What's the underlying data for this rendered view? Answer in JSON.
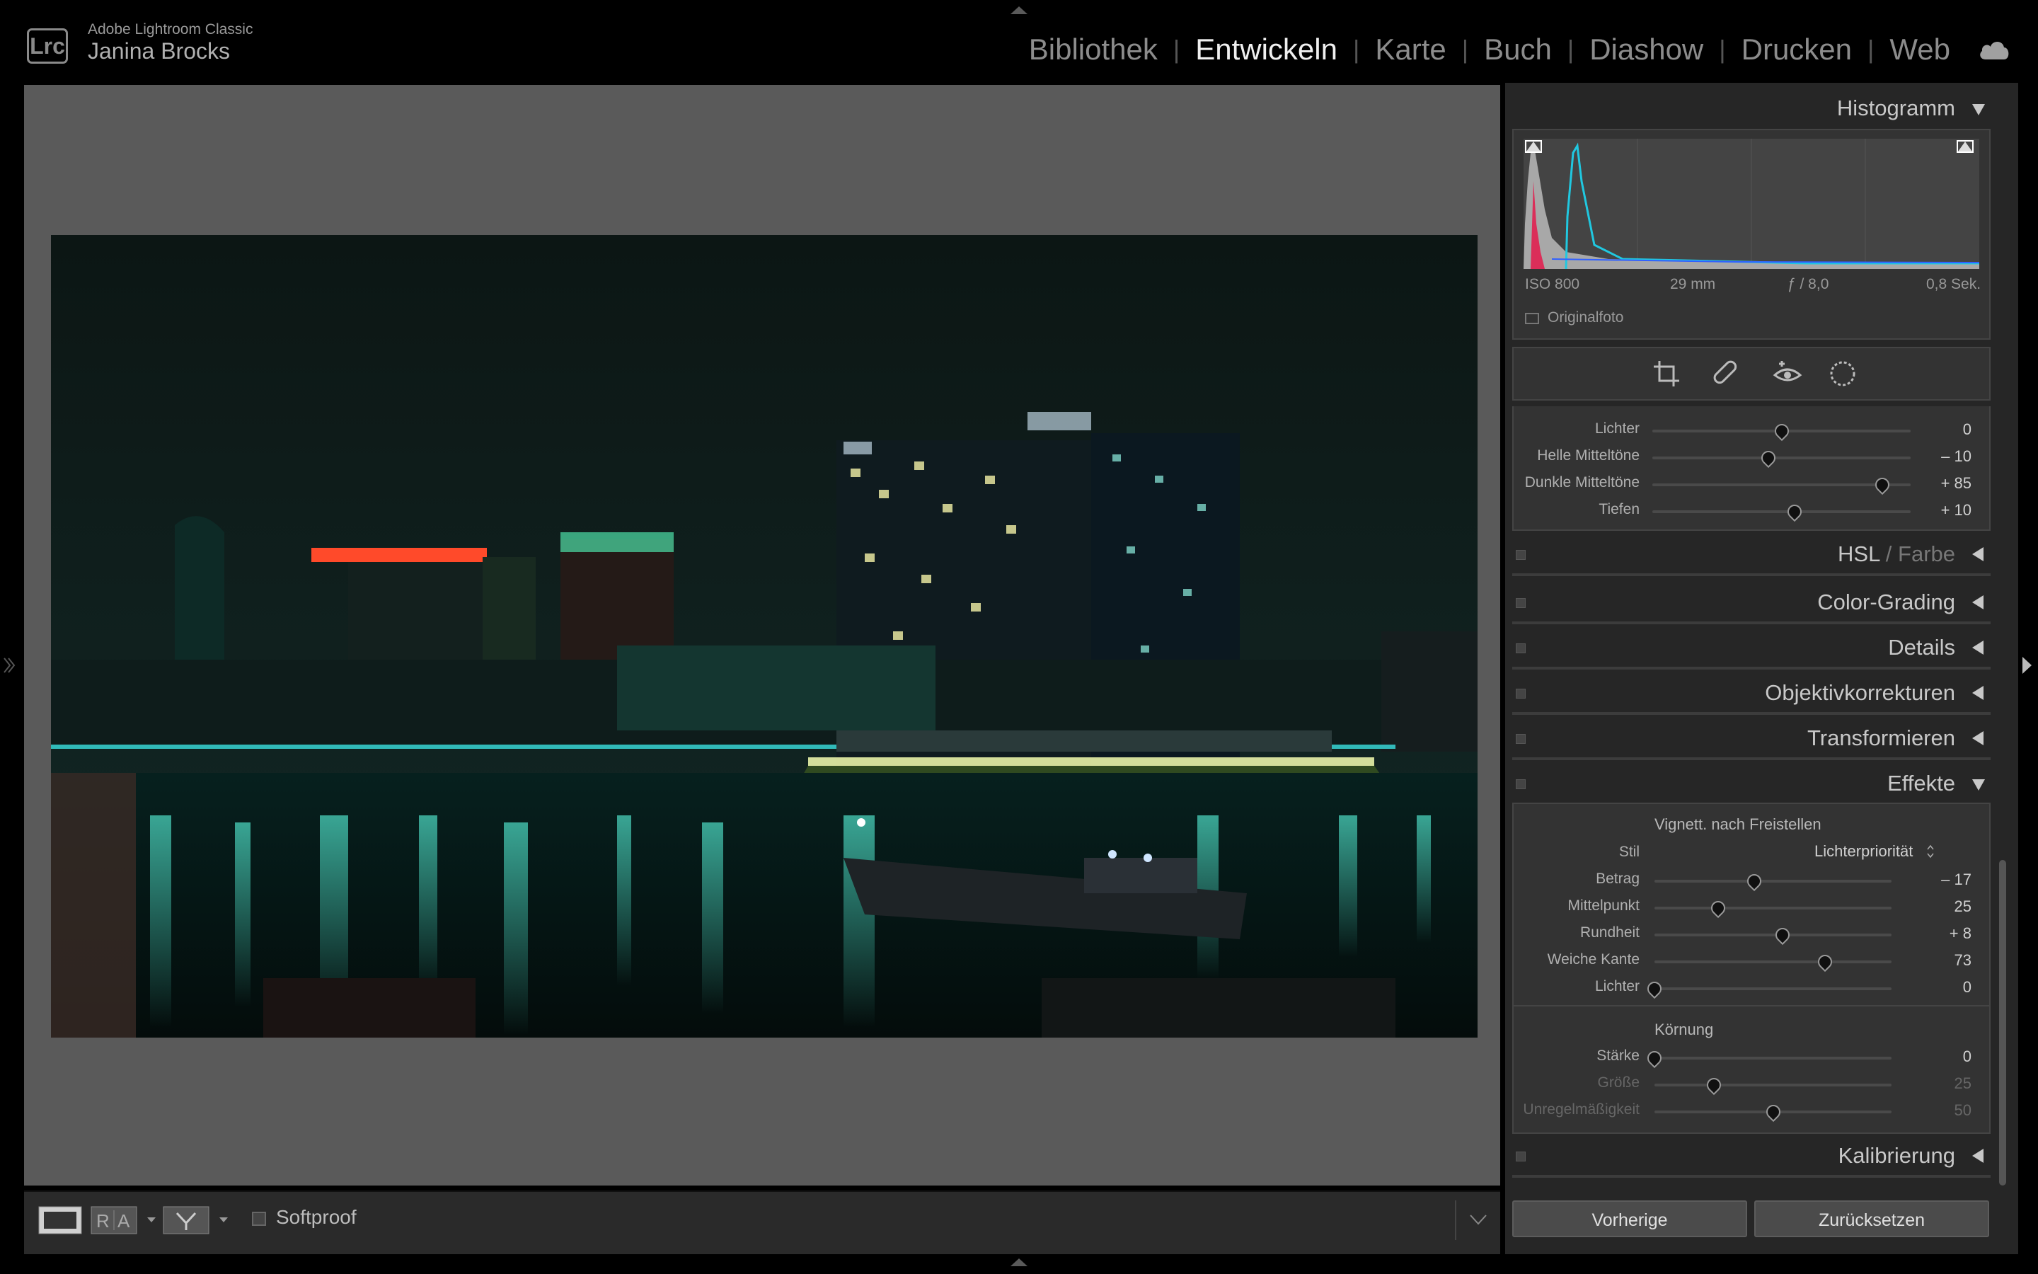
{
  "app": {
    "name": "Adobe Lightroom Classic",
    "user": "Janina Brocks",
    "logo": "Lrc"
  },
  "modules": [
    {
      "label": "Bibliothek",
      "active": false
    },
    {
      "label": "Entwickeln",
      "active": true
    },
    {
      "label": "Karte",
      "active": false
    },
    {
      "label": "Buch",
      "active": false
    },
    {
      "label": "Diashow",
      "active": false
    },
    {
      "label": "Drucken",
      "active": false
    },
    {
      "label": "Web",
      "active": false
    }
  ],
  "histogram": {
    "title": "Histogramm",
    "iso": "ISO 800",
    "focal": "29 mm",
    "aperture": "ƒ / 8,0",
    "shutter": "0,8 Sek.",
    "original_label": "Originalfoto"
  },
  "tone": [
    {
      "label": "Lichter",
      "value": "0",
      "pos": 0.5
    },
    {
      "label": "Helle Mitteltöne",
      "value": "– 10",
      "pos": 0.45
    },
    {
      "label": "Dunkle Mitteltöne",
      "value": "+ 85",
      "pos": 0.89
    },
    {
      "label": "Tiefen",
      "value": "+ 10",
      "pos": 0.55
    }
  ],
  "panels": {
    "hsl": "HSL",
    "hsl_sep": " / ",
    "farbe": "Farbe",
    "color_grading": "Color-Grading",
    "details": "Details",
    "objektiv": "Objektivkorrekturen",
    "transform": "Transformieren",
    "effekte": "Effekte",
    "kalibrierung": "Kalibrierung"
  },
  "vignette": {
    "title": "Vignett. nach Freistellen",
    "stil_label": "Stil",
    "stil_value": "Lichterpriorität",
    "sliders": [
      {
        "label": "Betrag",
        "value": "– 17",
        "pos": 0.42
      },
      {
        "label": "Mittelpunkt",
        "value": "25",
        "pos": 0.27
      },
      {
        "label": "Rundheit",
        "value": "+ 8",
        "pos": 0.54
      },
      {
        "label": "Weiche Kante",
        "value": "73",
        "pos": 0.72
      },
      {
        "label": "Lichter",
        "value": "0",
        "pos": 0.0
      }
    ]
  },
  "grain": {
    "title": "Körnung",
    "sliders": [
      {
        "label": "Stärke",
        "value": "0",
        "pos": 0.0,
        "dim": false
      },
      {
        "label": "Größe",
        "value": "25",
        "pos": 0.25,
        "dim": true
      },
      {
        "label": "Unregelmäßigkeit",
        "value": "50",
        "pos": 0.5,
        "dim": true
      }
    ]
  },
  "buttons": {
    "prev": "Vorherige",
    "reset": "Zurücksetzen"
  },
  "toolbar": {
    "softproof": "Softproof"
  },
  "colors": {
    "accent_active": "#f0f0f0",
    "panel": "#262626",
    "viewer": "#5a5a5a"
  }
}
